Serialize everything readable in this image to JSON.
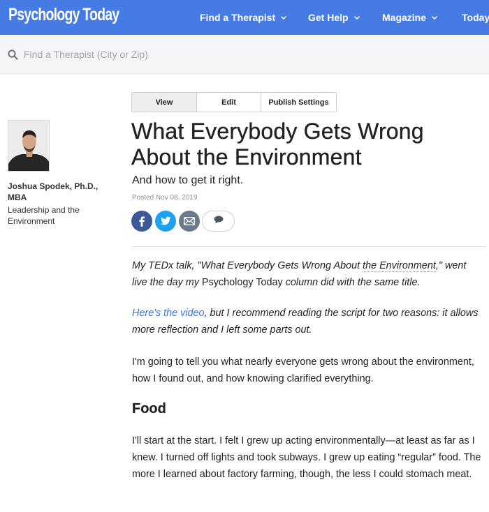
{
  "header": {
    "logo_text": "Psychology Today",
    "brand_color": "#477be4",
    "nav": [
      {
        "label": "Find a Therapist",
        "icon": "chevron-down-icon"
      },
      {
        "label": "Get Help",
        "icon": "chevron-down-icon"
      },
      {
        "label": "Magazine",
        "icon": "chevron-down-icon"
      },
      {
        "label": "Today"
      }
    ]
  },
  "search": {
    "placeholder": "Find a Therapist (City or Zip)",
    "icon": "search-icon"
  },
  "author": {
    "name": "Joshua Spodek, Ph.D., MBA",
    "blog_title": "Leadership and the Environment",
    "avatar_icon": "author-photo"
  },
  "tabs": [
    {
      "label": "View",
      "active": true
    },
    {
      "label": "Edit",
      "active": false
    },
    {
      "label": "Publish Settings",
      "active": false
    }
  ],
  "article": {
    "title": "What Everybody Gets Wrong About the Environment",
    "subtitle": "And how to get it right.",
    "posted": "Posted Nov 08, 2019",
    "share": {
      "facebook_color": "#3b5998",
      "twitter_color": "#1da1f2",
      "email_color": "#6b7a8c",
      "icons": [
        "facebook-icon",
        "twitter-icon",
        "email-icon",
        "comment-icon"
      ]
    },
    "p1": {
      "lead": "My TEDx talk, \"What Everybody Gets Wrong About ",
      "link": "the Environment",
      "mid": ",\" went live the day my ",
      "pub": "Psychology Today",
      "tail": " column did with the same title."
    },
    "p2": {
      "link": "Here's the video",
      "rest": ", but I recommend reading the script for two reasons: it allows more reflection and I left some parts out."
    },
    "p3": "I'm going to tell you what nearly everyone gets wrong about the environment, how I found out, and how knowing clarified everything.",
    "section_heading": "Food",
    "p4": "I'll start at the start. I felt I grew up acting environmentally—at least as far as I knew. I turned off lights and took subways. I grew up eating “regular” food. The more I learned about factory farming, though, the less I could stomach meat."
  }
}
